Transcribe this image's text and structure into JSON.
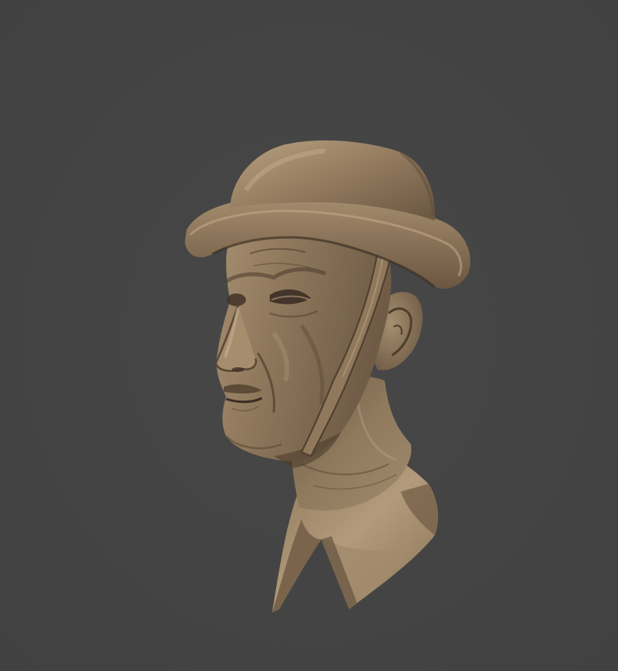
{
  "scene": {
    "subject": "soldier-bust-sculpt",
    "colors": {
      "background": "#444444",
      "clay_base": "#8a7358",
      "clay_light": "#b49c7c",
      "clay_mid": "#7d684f",
      "clay_dark": "#4a3b2c",
      "clay_shadow": "#33291f"
    }
  }
}
